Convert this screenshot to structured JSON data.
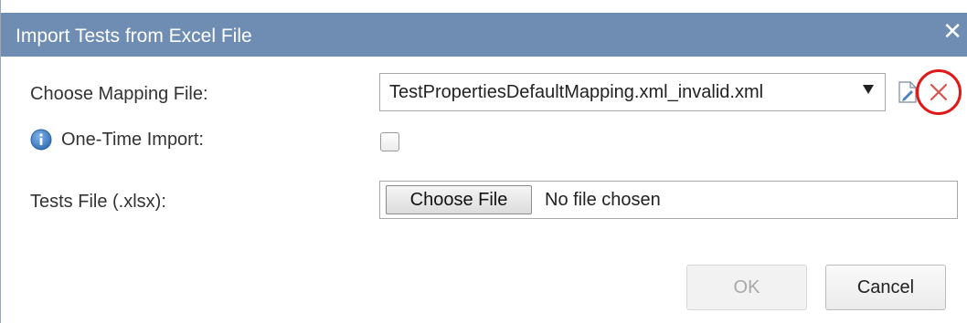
{
  "dialog": {
    "title": "Import Tests from Excel File",
    "close_icon": "close-icon"
  },
  "form": {
    "mapping_label": "Choose Mapping File:",
    "mapping_value": "TestPropertiesDefaultMapping.xml_invalid.xml",
    "onetime_label": "One-Time Import:",
    "onetime_checked": false,
    "tests_file_label": "Tests File (.xlsx):",
    "choose_file_label": "Choose File",
    "file_status": "No file chosen"
  },
  "buttons": {
    "ok_label": "OK",
    "cancel_label": "Cancel"
  },
  "colors": {
    "titlebar": "#6f8db3",
    "highlight_ring": "#e01818",
    "delete_x": "#d9534f",
    "info_icon": "#3b7bbf"
  }
}
